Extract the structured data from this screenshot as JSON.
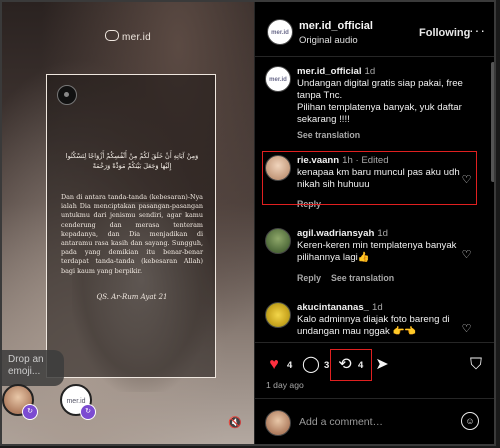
{
  "media": {
    "brand_text": "mer.id",
    "arabic_text": "وَمِنْ آيَاتِهِ أَنْ خَلَقَ لَكُمْ مِنْ أَنْفُسِكُمْ أَزْوَاجًا لِتَسْكُنُوا إِلَيْهَا وَجَعَلَ بَيْنَكُمْ مَوَدَّةً وَرَحْمَةً",
    "verse_text": "Dan di antara tanda-tanda (kebesaran)-Nya ialah Dia menciptakan pasangan-pasangan untukmu dari jenismu sendiri, agar kamu cenderung dan merasa tenteram kepadanya, dan Dia menjadikan di antaramu rasa kasih dan sayang. Sungguh, pada yang demikian itu benar-benar terdapat tanda-tanda (kebesaran Allah) bagi kaum yang berpikir.",
    "citation": "QS. Ar-Rum Ayat 21",
    "drop_hint": "Drop an emoji...",
    "sticker_label": "mer.id"
  },
  "header": {
    "username": "mer.id_official",
    "audio": "Original audio",
    "follow_label": "Following",
    "more_label": "···",
    "avatar_label": "mer.id"
  },
  "comments": [
    {
      "user": "mer.id_official",
      "time": "1d",
      "lines": [
        "Undangan digital gratis siap pakai, free tanpa Tnc.",
        "Pilihan templatenya banyak, yuk daftar sekarang !!!!"
      ],
      "action": "See translation"
    },
    {
      "user": "rie.vaann",
      "time": "1h · Edited",
      "text": "kenapaa km baru muncul pas aku udh nikah sih huhuuu",
      "reply": "Reply"
    },
    {
      "user": "agil.wadriansyah",
      "time": "1d",
      "text": "Keren-keren min templatenya banyak pilihannya lagi👍",
      "reply": "Reply",
      "translate": "See translation"
    },
    {
      "user": "akucintananas_",
      "time": "1d",
      "text": "Kalo adminnya diajak foto bareng di undangan mau nggak 👉👈"
    }
  ],
  "actions": {
    "likes": "4",
    "comments": "3",
    "reposts": "4",
    "time_ago": "1 day ago"
  },
  "add_comment": {
    "placeholder": "Add a comment…"
  }
}
